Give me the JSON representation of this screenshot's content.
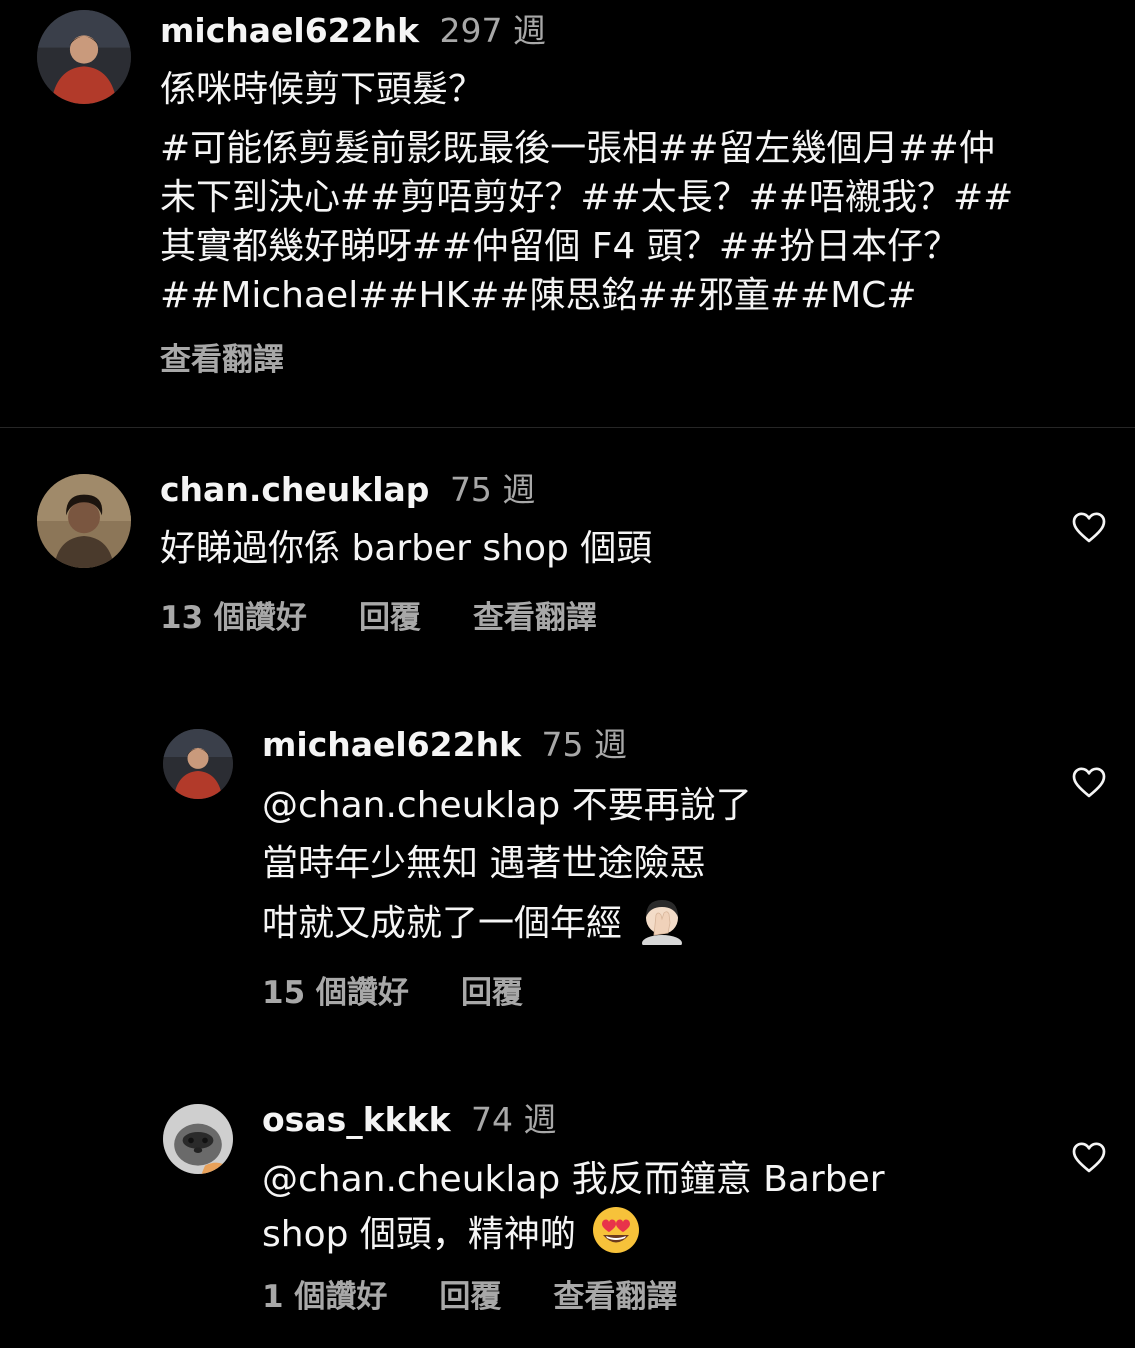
{
  "caption": {
    "username": "michael622hk",
    "time": "297 週",
    "lines": [
      "係咪時候剪下頭髮？",
      "#可能係剪髮前影既最後一張相##留左幾個月##仲",
      "未下到決心##剪唔剪好？##太長？##唔襯我？##",
      "其實都幾好睇呀##仲留個 F4 頭？##扮日本仔？",
      "##Michael##HK##陳思銘##邪童##MC#"
    ],
    "translate": "查看翻譯"
  },
  "comments": [
    {
      "username": "chan.cheuklap",
      "time": "75 週",
      "lines": [
        "好睇過你係 barber shop 個頭"
      ],
      "likes": "13 個讚好",
      "reply": "回覆",
      "translate": "查看翻譯"
    },
    {
      "username": "michael622hk",
      "time": "75 週",
      "lines": [
        "@chan.cheuklap 不要再說了",
        "當時年少無知 遇著世途險惡",
        "咁就又成就了一個年經"
      ],
      "emoji": "facepalm-emoji",
      "likes": "15 個讚好",
      "reply": "回覆"
    },
    {
      "username": "osas_kkkk",
      "time": "74 週",
      "lines": [
        "@chan.cheuklap 我反而鐘意 Barber",
        "shop 個頭，精神啲"
      ],
      "emoji": "heart-eyes-emoji",
      "likes": "1 個讚好",
      "reply": "回覆",
      "translate": "查看翻譯"
    }
  ],
  "colors": {
    "background": "#000000",
    "primary_text": "#f5f5f5",
    "secondary_text": "#a8a8a8",
    "divider": "#262626"
  }
}
